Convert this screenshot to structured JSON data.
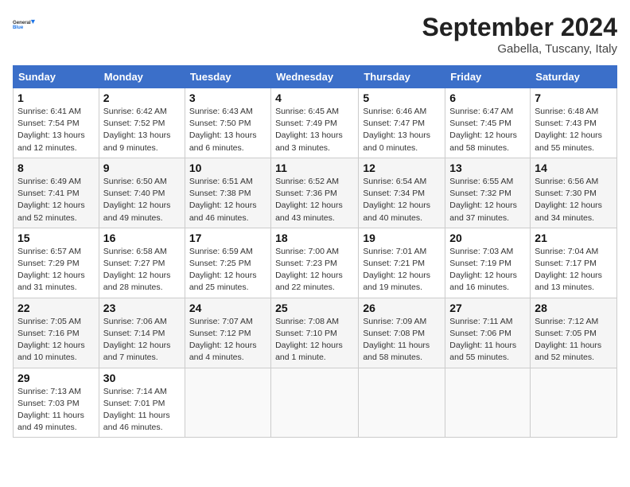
{
  "logo": {
    "line1": "General",
    "line2": "Blue"
  },
  "title": "September 2024",
  "subtitle": "Gabella, Tuscany, Italy",
  "columns": [
    "Sunday",
    "Monday",
    "Tuesday",
    "Wednesday",
    "Thursday",
    "Friday",
    "Saturday"
  ],
  "weeks": [
    [
      {
        "day": "1",
        "sunrise": "Sunrise: 6:41 AM",
        "sunset": "Sunset: 7:54 PM",
        "daylight": "Daylight: 13 hours and 12 minutes."
      },
      {
        "day": "2",
        "sunrise": "Sunrise: 6:42 AM",
        "sunset": "Sunset: 7:52 PM",
        "daylight": "Daylight: 13 hours and 9 minutes."
      },
      {
        "day": "3",
        "sunrise": "Sunrise: 6:43 AM",
        "sunset": "Sunset: 7:50 PM",
        "daylight": "Daylight: 13 hours and 6 minutes."
      },
      {
        "day": "4",
        "sunrise": "Sunrise: 6:45 AM",
        "sunset": "Sunset: 7:49 PM",
        "daylight": "Daylight: 13 hours and 3 minutes."
      },
      {
        "day": "5",
        "sunrise": "Sunrise: 6:46 AM",
        "sunset": "Sunset: 7:47 PM",
        "daylight": "Daylight: 13 hours and 0 minutes."
      },
      {
        "day": "6",
        "sunrise": "Sunrise: 6:47 AM",
        "sunset": "Sunset: 7:45 PM",
        "daylight": "Daylight: 12 hours and 58 minutes."
      },
      {
        "day": "7",
        "sunrise": "Sunrise: 6:48 AM",
        "sunset": "Sunset: 7:43 PM",
        "daylight": "Daylight: 12 hours and 55 minutes."
      }
    ],
    [
      {
        "day": "8",
        "sunrise": "Sunrise: 6:49 AM",
        "sunset": "Sunset: 7:41 PM",
        "daylight": "Daylight: 12 hours and 52 minutes."
      },
      {
        "day": "9",
        "sunrise": "Sunrise: 6:50 AM",
        "sunset": "Sunset: 7:40 PM",
        "daylight": "Daylight: 12 hours and 49 minutes."
      },
      {
        "day": "10",
        "sunrise": "Sunrise: 6:51 AM",
        "sunset": "Sunset: 7:38 PM",
        "daylight": "Daylight: 12 hours and 46 minutes."
      },
      {
        "day": "11",
        "sunrise": "Sunrise: 6:52 AM",
        "sunset": "Sunset: 7:36 PM",
        "daylight": "Daylight: 12 hours and 43 minutes."
      },
      {
        "day": "12",
        "sunrise": "Sunrise: 6:54 AM",
        "sunset": "Sunset: 7:34 PM",
        "daylight": "Daylight: 12 hours and 40 minutes."
      },
      {
        "day": "13",
        "sunrise": "Sunrise: 6:55 AM",
        "sunset": "Sunset: 7:32 PM",
        "daylight": "Daylight: 12 hours and 37 minutes."
      },
      {
        "day": "14",
        "sunrise": "Sunrise: 6:56 AM",
        "sunset": "Sunset: 7:30 PM",
        "daylight": "Daylight: 12 hours and 34 minutes."
      }
    ],
    [
      {
        "day": "15",
        "sunrise": "Sunrise: 6:57 AM",
        "sunset": "Sunset: 7:29 PM",
        "daylight": "Daylight: 12 hours and 31 minutes."
      },
      {
        "day": "16",
        "sunrise": "Sunrise: 6:58 AM",
        "sunset": "Sunset: 7:27 PM",
        "daylight": "Daylight: 12 hours and 28 minutes."
      },
      {
        "day": "17",
        "sunrise": "Sunrise: 6:59 AM",
        "sunset": "Sunset: 7:25 PM",
        "daylight": "Daylight: 12 hours and 25 minutes."
      },
      {
        "day": "18",
        "sunrise": "Sunrise: 7:00 AM",
        "sunset": "Sunset: 7:23 PM",
        "daylight": "Daylight: 12 hours and 22 minutes."
      },
      {
        "day": "19",
        "sunrise": "Sunrise: 7:01 AM",
        "sunset": "Sunset: 7:21 PM",
        "daylight": "Daylight: 12 hours and 19 minutes."
      },
      {
        "day": "20",
        "sunrise": "Sunrise: 7:03 AM",
        "sunset": "Sunset: 7:19 PM",
        "daylight": "Daylight: 12 hours and 16 minutes."
      },
      {
        "day": "21",
        "sunrise": "Sunrise: 7:04 AM",
        "sunset": "Sunset: 7:17 PM",
        "daylight": "Daylight: 12 hours and 13 minutes."
      }
    ],
    [
      {
        "day": "22",
        "sunrise": "Sunrise: 7:05 AM",
        "sunset": "Sunset: 7:16 PM",
        "daylight": "Daylight: 12 hours and 10 minutes."
      },
      {
        "day": "23",
        "sunrise": "Sunrise: 7:06 AM",
        "sunset": "Sunset: 7:14 PM",
        "daylight": "Daylight: 12 hours and 7 minutes."
      },
      {
        "day": "24",
        "sunrise": "Sunrise: 7:07 AM",
        "sunset": "Sunset: 7:12 PM",
        "daylight": "Daylight: 12 hours and 4 minutes."
      },
      {
        "day": "25",
        "sunrise": "Sunrise: 7:08 AM",
        "sunset": "Sunset: 7:10 PM",
        "daylight": "Daylight: 12 hours and 1 minute."
      },
      {
        "day": "26",
        "sunrise": "Sunrise: 7:09 AM",
        "sunset": "Sunset: 7:08 PM",
        "daylight": "Daylight: 11 hours and 58 minutes."
      },
      {
        "day": "27",
        "sunrise": "Sunrise: 7:11 AM",
        "sunset": "Sunset: 7:06 PM",
        "daylight": "Daylight: 11 hours and 55 minutes."
      },
      {
        "day": "28",
        "sunrise": "Sunrise: 7:12 AM",
        "sunset": "Sunset: 7:05 PM",
        "daylight": "Daylight: 11 hours and 52 minutes."
      }
    ],
    [
      {
        "day": "29",
        "sunrise": "Sunrise: 7:13 AM",
        "sunset": "Sunset: 7:03 PM",
        "daylight": "Daylight: 11 hours and 49 minutes."
      },
      {
        "day": "30",
        "sunrise": "Sunrise: 7:14 AM",
        "sunset": "Sunset: 7:01 PM",
        "daylight": "Daylight: 11 hours and 46 minutes."
      },
      null,
      null,
      null,
      null,
      null
    ]
  ]
}
